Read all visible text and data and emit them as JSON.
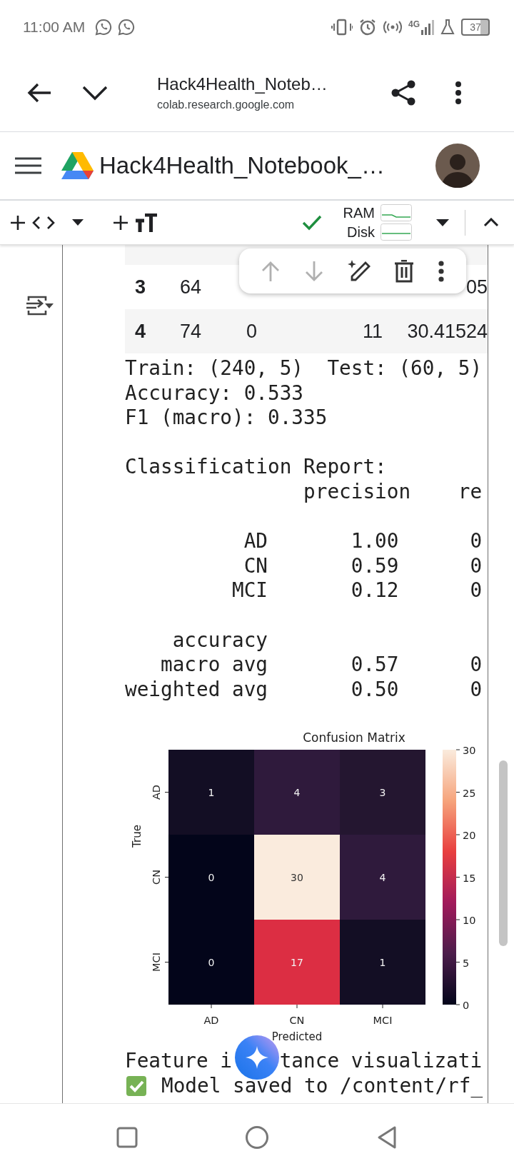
{
  "status_bar": {
    "time": "11:00 AM",
    "network": "4G",
    "battery": "37"
  },
  "browser_bar": {
    "title": "Hack4Health_Noteb…",
    "url": "colab.research.google.com"
  },
  "notebook_header": {
    "title": "Hack4Health_Notebook_…"
  },
  "toolbar": {
    "connected": true,
    "ram_label": "RAM",
    "disk_label": "Disk"
  },
  "cell_toolbar": [
    {
      "kind": "up",
      "disabled": true
    },
    {
      "kind": "down",
      "disabled": true
    },
    {
      "kind": "ai_edit",
      "disabled": false
    },
    {
      "kind": "delete",
      "disabled": false
    },
    {
      "kind": "more",
      "disabled": false
    }
  ],
  "table": {
    "rows": [
      {
        "index": "3",
        "column_1": "64",
        "column_4": "05"
      },
      {
        "index": "4",
        "column_1": "74",
        "column_2": "0",
        "column_3": "11",
        "column_4": "30.41524"
      }
    ]
  },
  "output": {
    "blocks": [
      [
        "Train: (240, 5)  Test: (60, 5)",
        "Accuracy: 0.533",
        "F1 (macro): 0.335"
      ],
      [
        "Classification Report:",
        "               precision    re"
      ],
      [
        "          AD       1.00      0",
        "          CN       0.59      0",
        "         MCI       0.12      0"
      ],
      [
        "    accuracy",
        "   macro avg       0.57      0",
        "weighted avg       0.50      0"
      ]
    ]
  },
  "confusion_matrix": {
    "title": "Confusion Matrix",
    "xlabel": "Predicted",
    "ylabel": "True",
    "x_labels": [
      "AD",
      "CN",
      "MCI"
    ],
    "y_labels": [
      "AD",
      "CN",
      "MCI"
    ],
    "rows": [
      [
        {
          "value": "1",
          "color": "#130e24"
        },
        {
          "value": "4",
          "color": "#2f1a3c"
        },
        {
          "value": "3",
          "color": "#241630"
        }
      ],
      [
        {
          "value": "0",
          "color": "#03051a"
        },
        {
          "value": "30",
          "color": "#faebdd"
        },
        {
          "value": "4",
          "color": "#2f1a3c"
        }
      ],
      [
        {
          "value": "0",
          "color": "#03051a"
        },
        {
          "value": "17",
          "color": "#dc2e43"
        },
        {
          "value": "1",
          "color": "#130e24"
        }
      ]
    ],
    "colorbar_ticks": [
      "30",
      "25",
      "20",
      "15",
      "10",
      "5",
      "0"
    ]
  },
  "output_tail": {
    "feature_line": [
      "Feature i",
      "tance visualizati"
    ],
    "saved_ok": true,
    "saved_line": "Model saved to /content/rf_"
  }
}
